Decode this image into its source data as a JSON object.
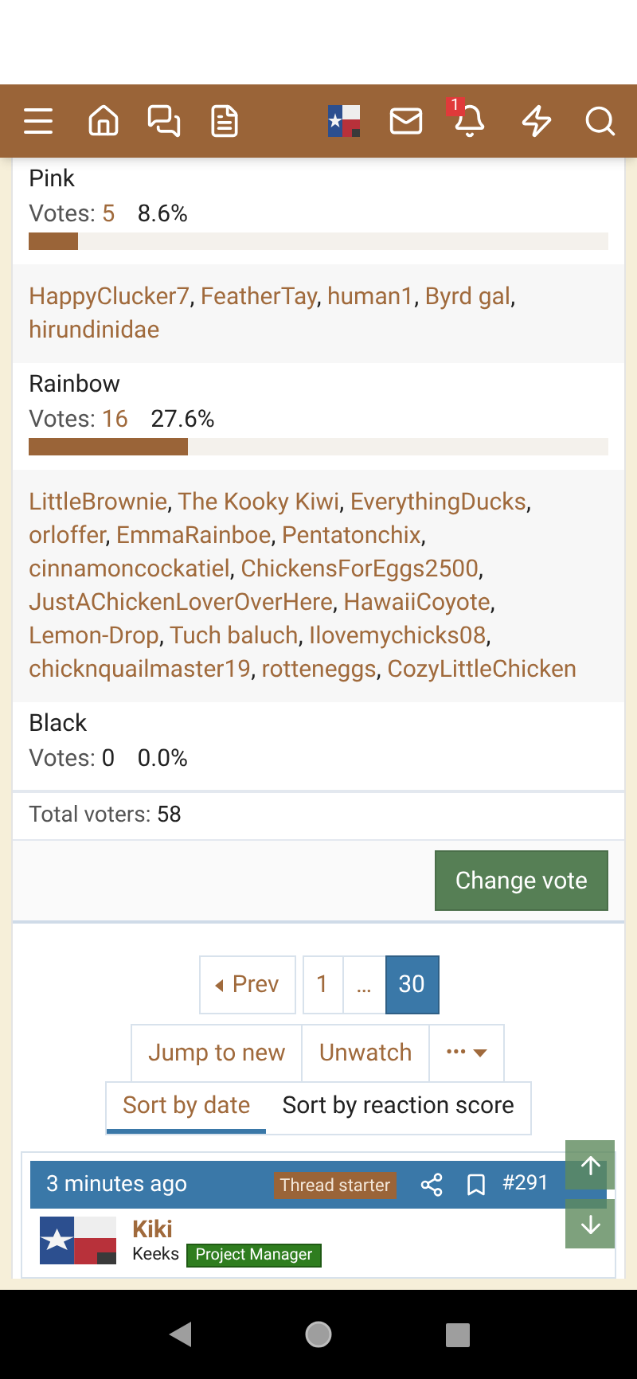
{
  "header": {
    "notification_count": "1"
  },
  "poll": {
    "options": [
      {
        "name": "Pink",
        "votes_label": "Votes:",
        "votes": "5",
        "percent": "8.6%",
        "level": 0.086,
        "voters": [
          "HappyClucker7",
          "FeatherTay",
          "human1",
          "Byrd gal",
          "hirundinidae"
        ]
      },
      {
        "name": "Rainbow",
        "votes_label": "Votes:",
        "votes": "16",
        "percent": "27.6%",
        "level": 0.276,
        "voters": [
          "LittleBrownie",
          "The Kooky Kiwi",
          "EverythingDucks",
          "orloffer",
          "EmmaRainboe",
          "Pentatonchix",
          "cinnamoncockatiel",
          "ChickensForEggs2500",
          "JustAChickenLoverOverHere",
          "HawaiiCoyote",
          "Lemon-Drop",
          "Tuch baluch",
          "Ilovemychicks08",
          "chicknquailmaster19",
          "rotteneggs",
          "CozyLittleChicken"
        ]
      },
      {
        "name": "Black",
        "votes_label": "Votes:",
        "votes": "0",
        "percent": "0.0%"
      }
    ],
    "separator": ",",
    "total_label": "Total voters:",
    "total": "58",
    "change_vote": "Change vote"
  },
  "pagination": [
    {
      "label": "Prev",
      "kind": "prev",
      "selected": false
    },
    {
      "label": "1",
      "kind": "page",
      "selected": false
    },
    {
      "label": "…",
      "kind": "gap",
      "selected": false
    },
    {
      "label": "30",
      "kind": "page",
      "selected": true
    }
  ],
  "thread_actions": [
    {
      "label": "Jump to new",
      "kind": "text"
    },
    {
      "label": "Unwatch",
      "kind": "text"
    },
    {
      "label": "•••",
      "kind": "menu"
    }
  ],
  "sort_tabs": [
    {
      "label": "Sort by date",
      "selected": true
    },
    {
      "label": "Sort by reaction score",
      "selected": false
    }
  ],
  "post": {
    "time": "3 minutes ago",
    "badge": "Thread starter",
    "number": "#291",
    "author": "Kiki",
    "user_title": "Keeks",
    "banner": "Project Manager"
  }
}
